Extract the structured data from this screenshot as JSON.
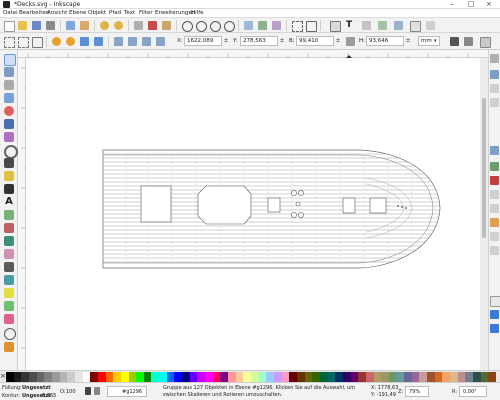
{
  "window": {
    "title": "*Decks.svg - Inkscape"
  },
  "menu": [
    "Datei",
    "Bearbeiten",
    "Ansicht",
    "Ebene",
    "Objekt",
    "Pfad",
    "Text",
    "Filter",
    "Erweiterungen",
    "Hilfe"
  ],
  "controls": {
    "x_label": "X:",
    "x_value": "1622,089",
    "y_label": "Y:",
    "y_value": "278,563",
    "b_label": "B:",
    "b_value": "99,410",
    "h_label": "H:",
    "h_value": "93,646",
    "unit": "mm"
  },
  "status": {
    "fill_label": "Füllung:",
    "fill_value": "Ungesetzt",
    "stroke_label": "Kontur:",
    "stroke_value": "Ungesetzt",
    "stroke_width": "0,265",
    "opacity_label": "O:",
    "opacity_value": "100",
    "layer": "#g1296",
    "message_line1": "Gruppe aus 127 Objekten in Ebene #g1296. Klicken Sie auf die Auswahl, um",
    "message_line2": "zwischen Skalieren und Rotieren umzuschalten.",
    "x_coord": "X: 1778,63",
    "y_coord": "Y: -191,49",
    "zoom_label": "Z:",
    "zoom_value": "79%",
    "rot_label": "R:",
    "rot_value": "0,00°"
  },
  "colors": {
    "accent": "#3a7bd5",
    "canvas": "#ffffff",
    "chrome": "#f2f2f2",
    "deck_stroke": "#6a6a6a"
  },
  "palette": [
    "#000000",
    "#1a1a1a",
    "#333333",
    "#4d4d4d",
    "#666666",
    "#808080",
    "#999999",
    "#b3b3b3",
    "#cccccc",
    "#e6e6e6",
    "#ffffff",
    "#800000",
    "#ff0000",
    "#ff6600",
    "#ffcc00",
    "#ffff00",
    "#99cc00",
    "#00ff00",
    "#008000",
    "#00ffcc",
    "#00ffff",
    "#0066ff",
    "#0000ff",
    "#000080",
    "#6600ff",
    "#cc00ff",
    "#ff00ff",
    "#ff0066",
    "#800080",
    "#ff9999",
    "#ffcc99",
    "#ffff99",
    "#ccff99",
    "#99ffcc",
    "#99ccff",
    "#cc99ff",
    "#ff99cc",
    "#660000",
    "#663300",
    "#666600",
    "#336600",
    "#006633",
    "#006666",
    "#003366",
    "#330066",
    "#660066",
    "#993333",
    "#cc6666",
    "#b39966",
    "#999966",
    "#669966",
    "#669999",
    "#666699",
    "#996699",
    "#cc9999",
    "#a0522d",
    "#d2691e",
    "#f4a460",
    "#deb887",
    "#bc8f8f",
    "#708090",
    "#2f4f4f",
    "#556b2f",
    "#8b4513"
  ]
}
